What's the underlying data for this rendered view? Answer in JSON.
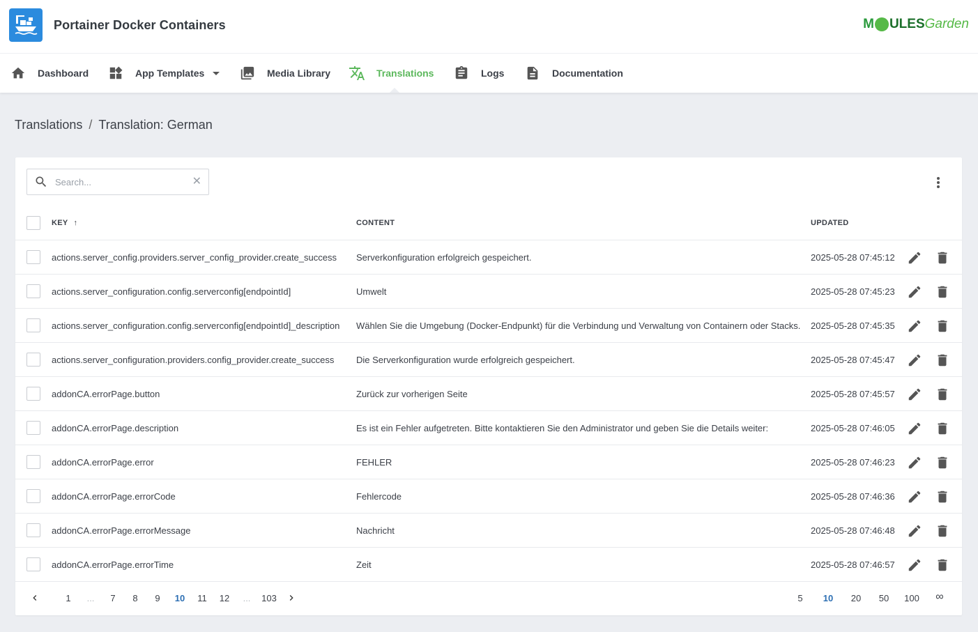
{
  "app": {
    "title": "Portainer Docker Containers",
    "logo_icon": "ship-containers-icon",
    "logo_color": "#2b8bde"
  },
  "brand": {
    "m": "M",
    "ules": "ULES",
    "garden": "Garden"
  },
  "nav": [
    {
      "label": "Dashboard",
      "icon": "home-icon",
      "active": false
    },
    {
      "label": "App Templates",
      "icon": "widgets-icon",
      "active": false,
      "dropdown": true
    },
    {
      "label": "Media Library",
      "icon": "image-library-icon",
      "active": false
    },
    {
      "label": "Translations",
      "icon": "translate-icon",
      "active": true
    },
    {
      "label": "Logs",
      "icon": "clipboard-icon",
      "active": false
    },
    {
      "label": "Documentation",
      "icon": "document-icon",
      "active": false
    }
  ],
  "accent_color": "#5cb85c",
  "breadcrumb": {
    "parent": "Translations",
    "separator": "/",
    "current": "Translation: German"
  },
  "search": {
    "placeholder": "Search...",
    "value": ""
  },
  "table": {
    "headers": {
      "key": "KEY",
      "key_sort": "↑",
      "content": "CONTENT",
      "updated": "UPDATED"
    },
    "rows": [
      {
        "key": "actions.server_config.providers.server_config_provider.create_success",
        "content": "Serverkonfiguration erfolgreich gespeichert.",
        "updated": "2025-05-28 07:45:12"
      },
      {
        "key": "actions.server_configuration.config.serverconfig[endpointId]",
        "content": "Umwelt",
        "updated": "2025-05-28 07:45:23"
      },
      {
        "key": "actions.server_configuration.config.serverconfig[endpointId]_description",
        "content": "Wählen Sie die Umgebung (Docker-Endpunkt) für die Verbindung und Verwaltung von Containern oder Stacks.",
        "updated": "2025-05-28 07:45:35"
      },
      {
        "key": "actions.server_configuration.providers.config_provider.create_success",
        "content": "Die Serverkonfiguration wurde erfolgreich gespeichert.",
        "updated": "2025-05-28 07:45:47"
      },
      {
        "key": "addonCA.errorPage.button",
        "content": "Zurück zur vorherigen Seite",
        "updated": "2025-05-28 07:45:57"
      },
      {
        "key": "addonCA.errorPage.description",
        "content": "Es ist ein Fehler aufgetreten. Bitte kontaktieren Sie den Administrator und geben Sie die Details weiter:",
        "updated": "2025-05-28 07:46:05"
      },
      {
        "key": "addonCA.errorPage.error",
        "content": "FEHLER",
        "updated": "2025-05-28 07:46:23"
      },
      {
        "key": "addonCA.errorPage.errorCode",
        "content": "Fehlercode",
        "updated": "2025-05-28 07:46:36"
      },
      {
        "key": "addonCA.errorPage.errorMessage",
        "content": "Nachricht",
        "updated": "2025-05-28 07:46:48"
      },
      {
        "key": "addonCA.errorPage.errorTime",
        "content": "Zeit",
        "updated": "2025-05-28 07:46:57"
      }
    ]
  },
  "pagination": {
    "pages": [
      "1",
      "...",
      "7",
      "8",
      "9",
      "10",
      "11",
      "12",
      "...",
      "103"
    ],
    "current_page": "10",
    "page_sizes": [
      "5",
      "10",
      "20",
      "50",
      "100",
      "∞"
    ],
    "current_size": "10"
  }
}
